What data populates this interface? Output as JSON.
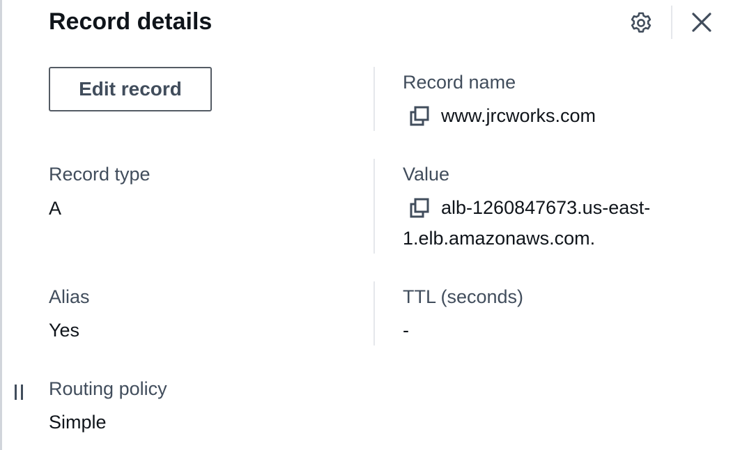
{
  "panel": {
    "title": "Record details",
    "settings_icon": "gear-icon",
    "close_icon": "close-icon"
  },
  "actions": {
    "edit_record_label": "Edit record"
  },
  "fields": {
    "record_name": {
      "label": "Record name",
      "value": "www.jrcworks.com",
      "icon": "copy-icon"
    },
    "record_type": {
      "label": "Record type",
      "value": "A"
    },
    "value": {
      "label": "Value",
      "value_line1": "alb-1260847673.us-east-",
      "value_line2": "1.elb.amazonaws.com.",
      "icon": "copy-icon"
    },
    "alias": {
      "label": "Alias",
      "value": "Yes"
    },
    "ttl": {
      "label": "TTL (seconds)",
      "value": "-"
    },
    "routing_policy": {
      "label": "Routing policy",
      "value": "Simple"
    }
  },
  "colors": {
    "text_primary": "#0f141a",
    "text_label": "#414d5c",
    "icon": "#414d5c",
    "divider": "#e5e7eb",
    "button_border": "#545b64"
  }
}
